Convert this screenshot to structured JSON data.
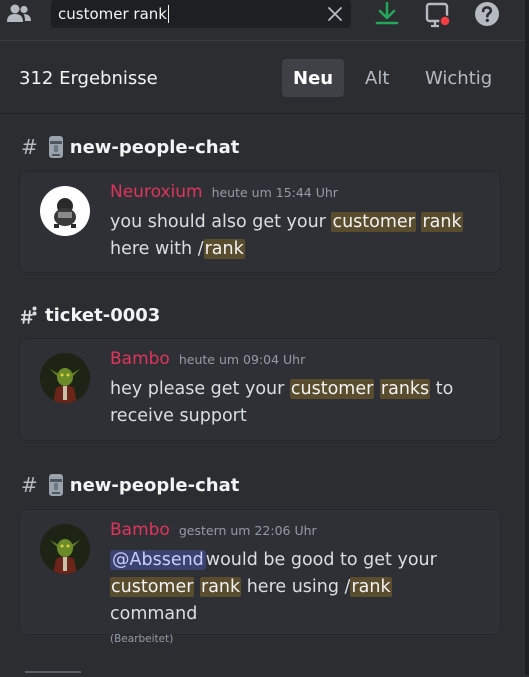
{
  "search": {
    "query": "customer rank"
  },
  "results": {
    "count_label": "312 Ergebnisse",
    "sort_tabs": [
      {
        "label": "Neu",
        "active": true
      },
      {
        "label": "Alt",
        "active": false
      },
      {
        "label": "Wichtig",
        "active": false
      }
    ]
  },
  "groups": [
    {
      "channel": "new-people-chat",
      "channel_icon": "moai-icon",
      "message": {
        "author": "Neuroxium",
        "timestamp": "heute um 15:44 Uhr",
        "parts": [
          "you should also get your ",
          "customer",
          " ",
          "rank",
          "here with /",
          "rank"
        ]
      }
    },
    {
      "channel": "ticket-0003",
      "channel_icon": "thread-hash-icon",
      "message": {
        "author": "Bambo",
        "timestamp": "heute um 09:04 Uhr",
        "parts": [
          "hey please get your ",
          "customer",
          " ",
          "ranks",
          " to",
          "receive support"
        ]
      }
    },
    {
      "channel": "new-people-chat",
      "channel_icon": "moai-icon",
      "message": {
        "author": "Bambo",
        "timestamp": "gestern um 22:06 Uhr",
        "mention": "@Abssend",
        "parts": [
          "would be good to get your",
          "customer",
          " ",
          "rank",
          " here using /",
          "rank",
          " command"
        ],
        "edited": "(Bearbeitet)"
      }
    }
  ],
  "colors": {
    "background": "#2b2d31",
    "card": "#2e3035",
    "author": "#e0345a",
    "highlight": "#5a4d2e",
    "mention": "#3c4270",
    "download": "#23a55a",
    "notification_dot": "#f23f43"
  }
}
